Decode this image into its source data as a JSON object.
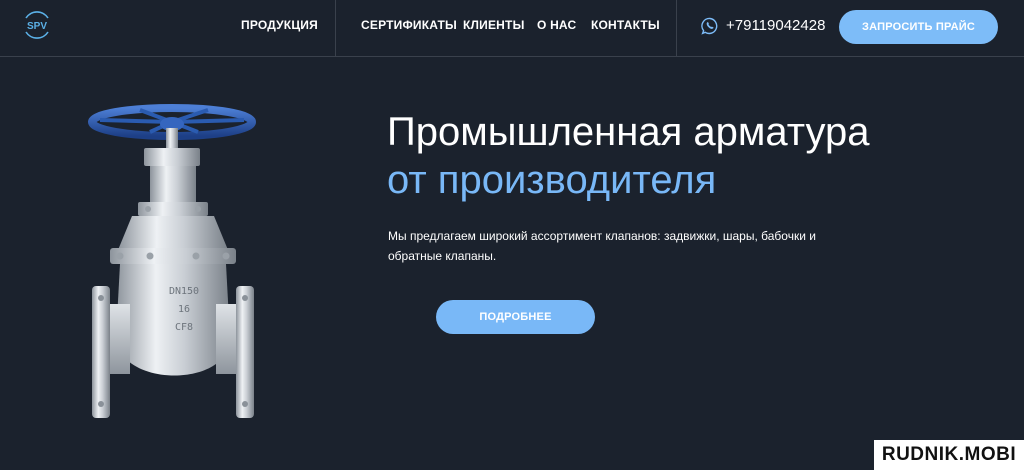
{
  "header": {
    "logo_text": "SPV",
    "nav": [
      "ПРОДУКЦИЯ",
      "СЕРТИФИКАТЫ",
      "КЛИЕНТЫ",
      "О НАС",
      "КОНТАКТЫ"
    ],
    "phone": "+79119042428",
    "phone_icon": "whatsapp-icon",
    "cta_label": "ЗАПРОСИТЬ ПРАЙС"
  },
  "hero": {
    "title_line1": "Промышленная арматура",
    "title_line2": "от производителя",
    "description": "Мы предлагаем широкий ассортимент клапанов: задвижки, шары, бабочки и обратные клапаны.",
    "button_label": "ПОДРОБНЕЕ",
    "valve_markings": [
      "DN150",
      "16",
      "CF8"
    ]
  },
  "watermark": "RUDNIK.MOBI",
  "colors": {
    "background": "#1b222d",
    "accent": "#79b8f7",
    "divider": "#3a414c",
    "handwheel": "#2c5fb7"
  }
}
